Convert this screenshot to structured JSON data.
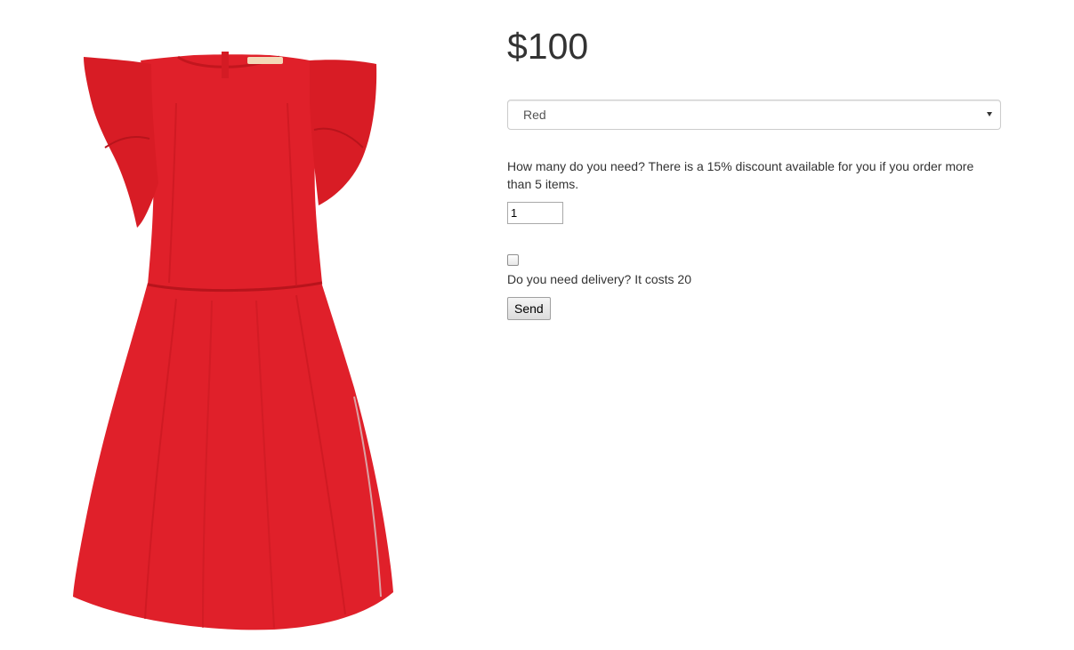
{
  "product": {
    "price": "$100",
    "image_alt": "red-dress",
    "color_select": {
      "selected": "Red"
    },
    "quantity": {
      "label": "How many do you need? There is a 15% discount available for you if you order more than 5 items.",
      "value": "1"
    },
    "delivery": {
      "checked": false,
      "label": "Do you need delivery? It costs 20"
    },
    "send_label": "Send"
  },
  "colors": {
    "dress": "#e0202a",
    "dress_shadow": "#b8141c",
    "dress_highlight": "#ee3a40"
  }
}
